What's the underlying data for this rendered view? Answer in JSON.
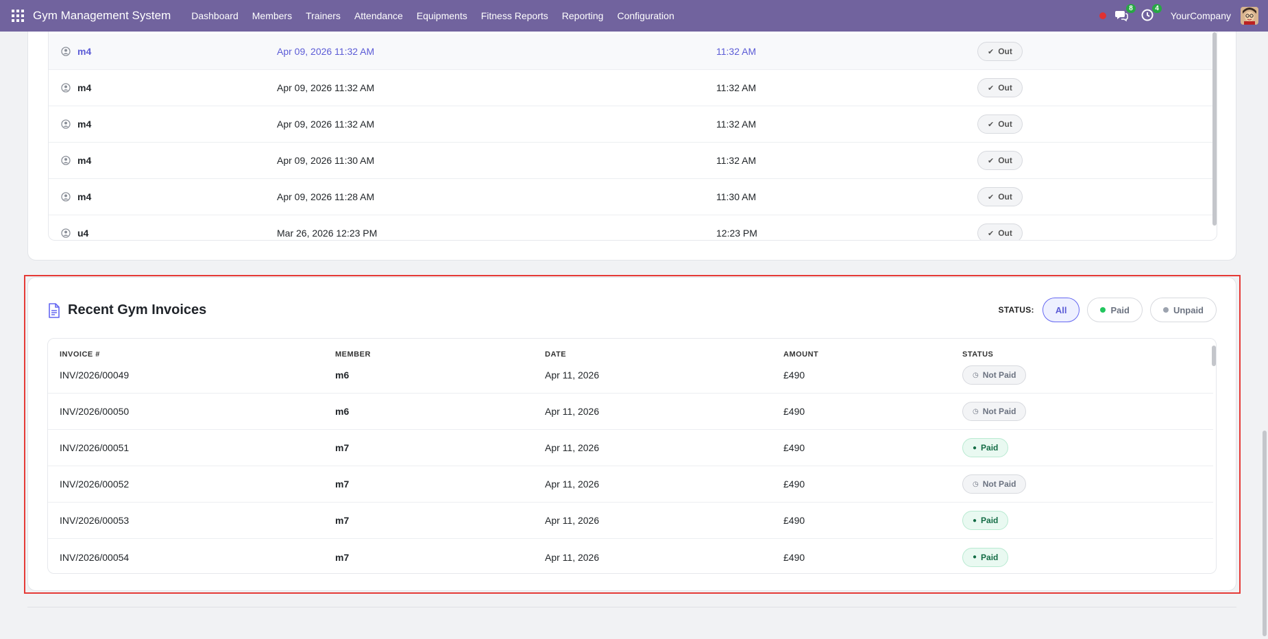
{
  "navbar": {
    "brand": "Gym Management System",
    "menu": [
      "Dashboard",
      "Members",
      "Trainers",
      "Attendance",
      "Equipments",
      "Fitness Reports",
      "Reporting",
      "Configuration"
    ],
    "messages_count": "8",
    "activities_count": "4",
    "company": "YourCompany"
  },
  "attendance": {
    "rows": [
      {
        "member": "m4",
        "check_in": "Apr 09, 2026 11:32 AM",
        "check_out": "11:32 AM",
        "status": "Out"
      },
      {
        "member": "m4",
        "check_in": "Apr 09, 2026 11:32 AM",
        "check_out": "11:32 AM",
        "status": "Out"
      },
      {
        "member": "m4",
        "check_in": "Apr 09, 2026 11:32 AM",
        "check_out": "11:32 AM",
        "status": "Out"
      },
      {
        "member": "m4",
        "check_in": "Apr 09, 2026 11:30 AM",
        "check_out": "11:32 AM",
        "status": "Out"
      },
      {
        "member": "m4",
        "check_in": "Apr 09, 2026 11:28 AM",
        "check_out": "11:30 AM",
        "status": "Out"
      },
      {
        "member": "u4",
        "check_in": "Mar 26, 2026 12:23 PM",
        "check_out": "12:23 PM",
        "status": "Out"
      }
    ]
  },
  "invoices": {
    "title": "Recent Gym Invoices",
    "filter_label": "STATUS:",
    "filters": {
      "all": "All",
      "paid": "Paid",
      "unpaid": "Unpaid"
    },
    "colors": {
      "paid_dot": "#22c55e",
      "unpaid_dot": "#9ca3af",
      "accent": "#6366f1"
    },
    "headers": {
      "invoice": "INVOICE #",
      "member": "MEMBER",
      "date": "DATE",
      "amount": "AMOUNT",
      "status": "STATUS"
    },
    "rows": [
      {
        "invoice": "INV/2026/00049",
        "member": "m6",
        "date": "Apr 11, 2026",
        "amount": "£490",
        "status": "Not Paid",
        "paid": false
      },
      {
        "invoice": "INV/2026/00050",
        "member": "m6",
        "date": "Apr 11, 2026",
        "amount": "£490",
        "status": "Not Paid",
        "paid": false
      },
      {
        "invoice": "INV/2026/00051",
        "member": "m7",
        "date": "Apr 11, 2026",
        "amount": "£490",
        "status": "Paid",
        "paid": true
      },
      {
        "invoice": "INV/2026/00052",
        "member": "m7",
        "date": "Apr 11, 2026",
        "amount": "£490",
        "status": "Not Paid",
        "paid": false
      },
      {
        "invoice": "INV/2026/00053",
        "member": "m7",
        "date": "Apr 11, 2026",
        "amount": "£490",
        "status": "Paid",
        "paid": true
      },
      {
        "invoice": "INV/2026/00054",
        "member": "m7",
        "date": "Apr 11, 2026",
        "amount": "£490",
        "status": "Paid",
        "paid": true
      }
    ]
  }
}
